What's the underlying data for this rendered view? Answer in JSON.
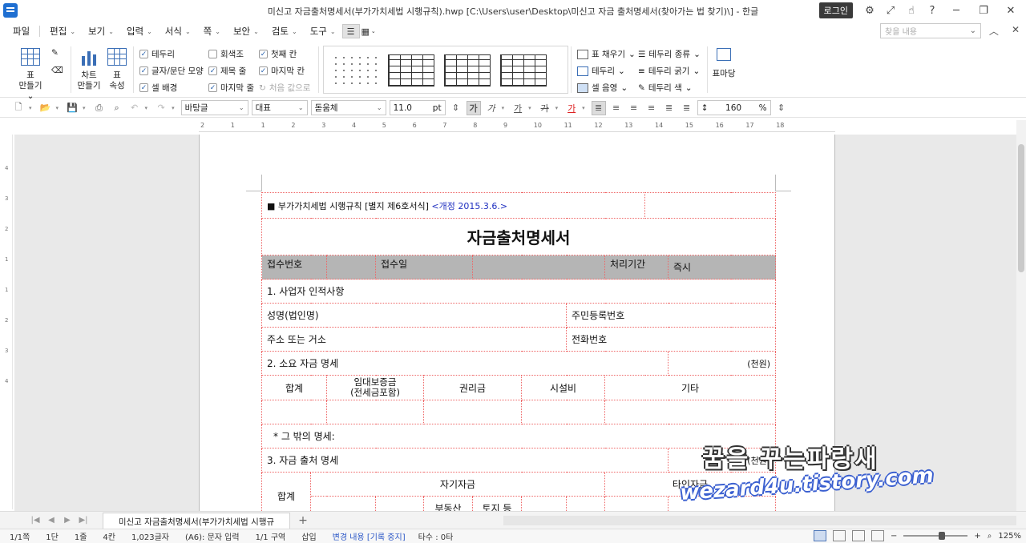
{
  "window": {
    "title": "미신고 자금출처명세서(부가가치세법 시행규칙).hwp [C:\\Users\\user\\Desktop\\미신고 자금 출처명세서(찾아가는 법 찾기)\\] - 한글",
    "login_label": "로그인"
  },
  "menu": {
    "items": [
      "파일",
      "편집",
      "보기",
      "입력",
      "서식",
      "쪽",
      "보안",
      "검토",
      "도구"
    ],
    "find_placeholder": "찾을 내용"
  },
  "ribbon": {
    "table_create": [
      "표",
      "만들기"
    ],
    "chart_create": [
      "차트",
      "만들기"
    ],
    "table_props": [
      "표",
      "속성"
    ],
    "checks": [
      {
        "label": "테두리",
        "checked": true
      },
      {
        "label": "글자/문단 모양",
        "checked": true
      },
      {
        "label": "셀 배경",
        "checked": true
      },
      {
        "label": "회색조",
        "checked": false
      },
      {
        "label": "제목 줄",
        "checked": true
      },
      {
        "label": "마지막 줄",
        "checked": true
      },
      {
        "label": "첫째 칸",
        "checked": true
      },
      {
        "label": "마지막 칸",
        "checked": true
      }
    ],
    "reset_label": "처음 값으로",
    "right_items": [
      "표 채우기",
      "테두리",
      "셀 음영",
      "테두리 종류",
      "테두리 굵기",
      "테두리 색"
    ],
    "table_wizard": "표마당"
  },
  "toolbar": {
    "style": "바탕글",
    "lang": "대표",
    "font": "돋움체",
    "size": "11.0",
    "size_unit": "pt",
    "line_spacing": "160",
    "line_unit": "%",
    "bold_glyph": "가",
    "italic_glyph": "가",
    "underline_glyph": "가",
    "strike_glyph": "가",
    "color_glyph": "가"
  },
  "ruler": {
    "h_labels": [
      "2",
      "1",
      "1",
      "2",
      "3",
      "4",
      "5",
      "6",
      "7",
      "8",
      "9",
      "10",
      "11",
      "12",
      "13",
      "14",
      "15",
      "16",
      "17",
      "18"
    ],
    "v_labels": [
      "4",
      "3",
      "2",
      "1",
      "1",
      "2",
      "3",
      "4"
    ]
  },
  "document": {
    "form_ref": "■ 부가가치세법 시행규칙 [별지 제6호서식]",
    "revision": "<개정 2015.3.6.>",
    "title": "자금출처명세서",
    "receipt_no": "접수번호",
    "receipt_date": "접수일",
    "processing_period": "처리기간",
    "processing_value": "즉시",
    "sec1": "1. 사업자 인적사항",
    "name_label": "성명(법인명)",
    "resident_no": "주민등록번호",
    "address_label": "주소 또는 거소",
    "phone_label": "전화번호",
    "sec2": "2. 소요 자금 명세",
    "unit": "(천원)",
    "cols2": [
      "합계",
      "임대보증금\n(전세금포함)",
      "권리금",
      "시설비",
      "기타"
    ],
    "other_detail": "* 그 밖의 명세:",
    "sec3": "3. 자금 출처 명세",
    "unit3": "(천원)",
    "total_label": "합계",
    "own_funds": "자기자금",
    "other_funds": "타인자금",
    "sub_cols": [
      "",
      "",
      "부동산",
      "토지 등",
      "",
      "",
      "",
      ""
    ]
  },
  "watermark": {
    "line1": "꿈을 꾸는파랑새",
    "line2": "wezard4u.tistory.com"
  },
  "tabs": {
    "doc_tab": "미신고 자금출처명세서(부가가치세법 시행규칙)"
  },
  "status": {
    "page": "1/1쪽",
    "column": "1단",
    "line": "1줄",
    "col_pos": "4칸",
    "chars": "1,023글자",
    "cell": "(A6): 문자 입력",
    "section": "1/1 구역",
    "insert": "삽입",
    "track": "변경 내용 [기록 중지]",
    "typo": "타수 : 0타",
    "zoom": "125%"
  }
}
